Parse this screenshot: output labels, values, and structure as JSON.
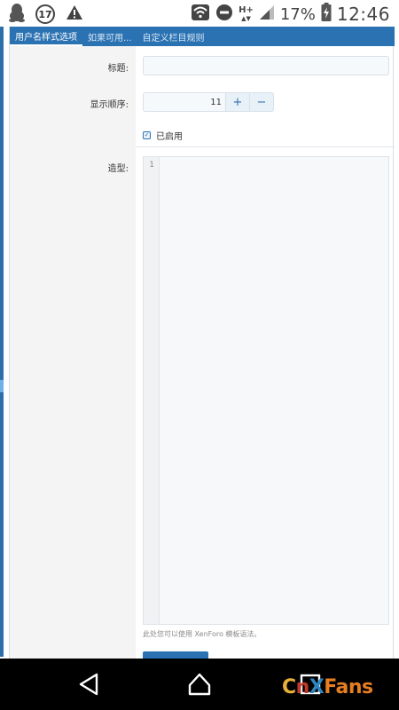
{
  "status_bar": {
    "notification_count": "17",
    "network_type": "H+",
    "battery_percent": "17%",
    "time": "12:46",
    "icons": [
      "qq-penguin-icon",
      "notification-count-icon",
      "warning-icon",
      "wifi-icon",
      "do-not-disturb-icon",
      "signal-icon",
      "battery-charging-icon"
    ]
  },
  "tabs": [
    {
      "label": "用户名样式选项",
      "active": true
    },
    {
      "label": "如果可用...",
      "active": false
    },
    {
      "label": "自定义栏目规则",
      "active": false
    }
  ],
  "form": {
    "title_label": "标题:",
    "title_value": "",
    "order_label": "显示顺序:",
    "order_value": "11",
    "plus_label": "+",
    "minus_label": "−",
    "enabled_label": "已启用",
    "enabled_checked": true,
    "style_label": "造型:",
    "editor_line_number": "1",
    "editor_value": "",
    "hint": "此处您可以使用 XenForo 模板语法。"
  },
  "nav": {
    "icons": [
      "back-icon",
      "home-icon",
      "recents-icon"
    ]
  },
  "watermark": {
    "parts": [
      "C",
      "n",
      "X",
      "Fans"
    ]
  },
  "colors": {
    "accent": "#2b72b2",
    "label_bg": "#f4f4f4",
    "nav_bg": "#000000"
  }
}
